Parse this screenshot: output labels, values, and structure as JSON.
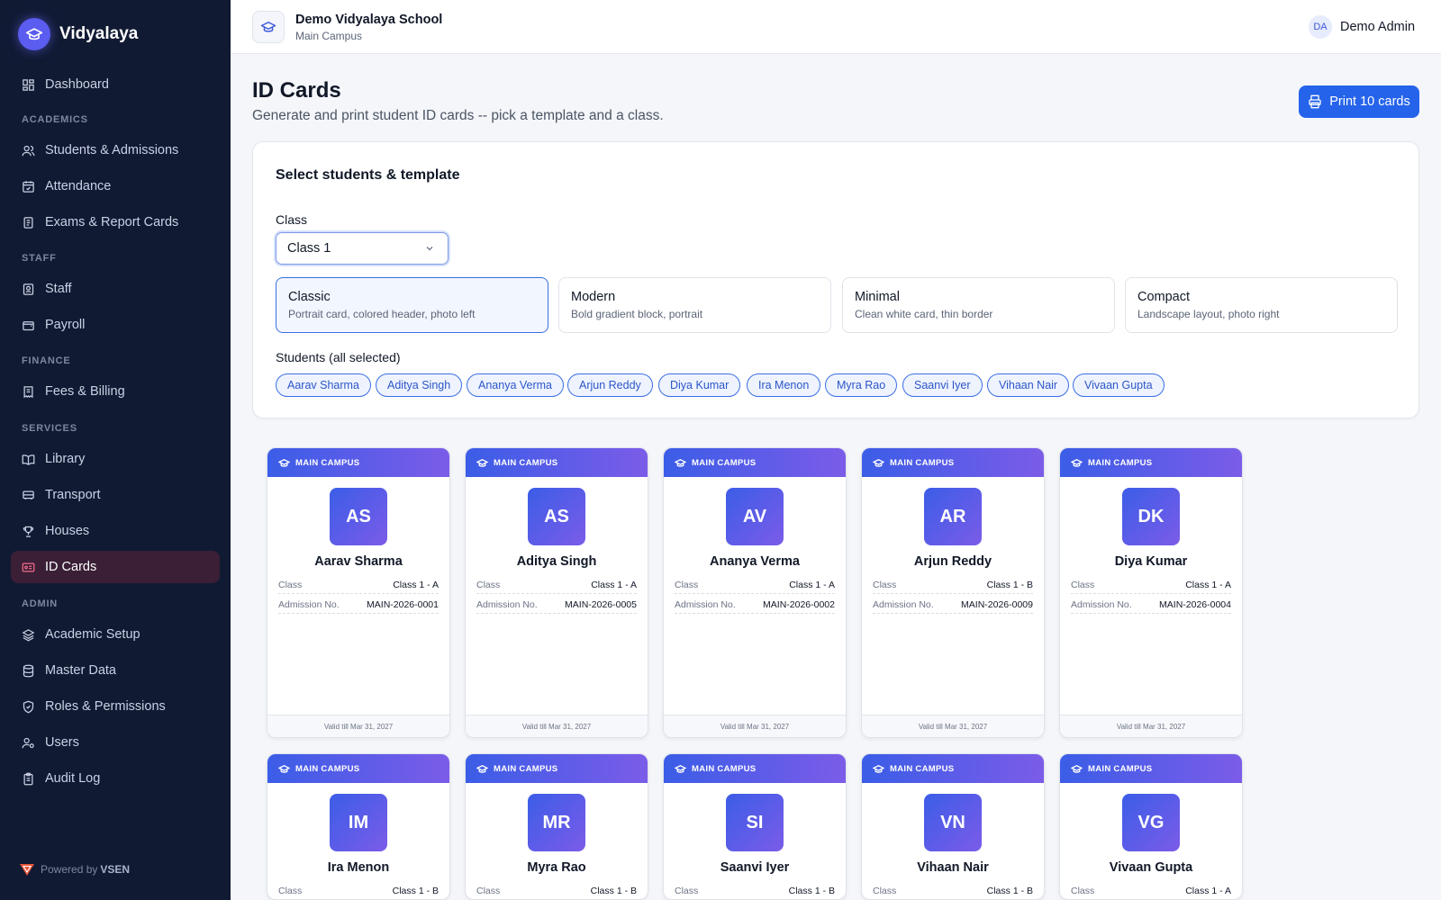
{
  "brand": {
    "name": "Vidyalaya"
  },
  "nav": {
    "dashboard": "Dashboard",
    "section_academics": "ACADEMICS",
    "students": "Students & Admissions",
    "attendance": "Attendance",
    "exams": "Exams & Report Cards",
    "section_staff": "STAFF",
    "staff": "Staff",
    "payroll": "Payroll",
    "section_finance": "FINANCE",
    "fees": "Fees & Billing",
    "section_services": "SERVICES",
    "library": "Library",
    "transport": "Transport",
    "houses": "Houses",
    "id_cards": "ID Cards",
    "section_admin": "ADMIN",
    "academic_setup": "Academic Setup",
    "master_data": "Master Data",
    "roles": "Roles & Permissions",
    "users": "Users",
    "audit_log": "Audit Log"
  },
  "footer": {
    "powered_prefix": "Powered by",
    "powered_brand": "VSEN"
  },
  "topbar": {
    "school_name": "Demo Vidyalaya School",
    "campus": "Main Campus",
    "user_initials": "DA",
    "user_name": "Demo Admin"
  },
  "page": {
    "title": "ID Cards",
    "subtitle": "Generate and print student ID cards -- pick a template and a class.",
    "print_button": "Print 10 cards"
  },
  "panel": {
    "title": "Select students & template",
    "class_label": "Class",
    "class_value": "Class 1",
    "students_label": "Students (all selected)",
    "templates": [
      {
        "name": "Classic",
        "desc": "Portrait card, colored header, photo left"
      },
      {
        "name": "Modern",
        "desc": "Bold gradient block, portrait"
      },
      {
        "name": "Minimal",
        "desc": "Clean white card, thin border"
      },
      {
        "name": "Compact",
        "desc": "Landscape layout, photo right"
      }
    ],
    "students": [
      "Aarav Sharma",
      "Aditya Singh",
      "Ananya Verma",
      "Arjun Reddy",
      "Diya Kumar",
      "Ira Menon",
      "Myra Rao",
      "Saanvi Iyer",
      "Vihaan Nair",
      "Vivaan Gupta"
    ]
  },
  "card_labels": {
    "campus": "MAIN CAMPUS",
    "class": "Class",
    "admission": "Admission No.",
    "valid": "Valid till Mar 31, 2027"
  },
  "cards": [
    {
      "initials": "AS",
      "name": "Aarav Sharma",
      "class": "Class 1 - A",
      "admission": "MAIN-2026-0001"
    },
    {
      "initials": "AS",
      "name": "Aditya Singh",
      "class": "Class 1 - A",
      "admission": "MAIN-2026-0005"
    },
    {
      "initials": "AV",
      "name": "Ananya Verma",
      "class": "Class 1 - A",
      "admission": "MAIN-2026-0002"
    },
    {
      "initials": "AR",
      "name": "Arjun Reddy",
      "class": "Class 1 - B",
      "admission": "MAIN-2026-0009"
    },
    {
      "initials": "DK",
      "name": "Diya Kumar",
      "class": "Class 1 - A",
      "admission": "MAIN-2026-0004"
    },
    {
      "initials": "IM",
      "name": "Ira Menon",
      "class": "Class 1 - B"
    },
    {
      "initials": "MR",
      "name": "Myra Rao",
      "class": "Class 1 - B"
    },
    {
      "initials": "SI",
      "name": "Saanvi Iyer",
      "class": "Class 1 - B"
    },
    {
      "initials": "VN",
      "name": "Vihaan Nair",
      "class": "Class 1 - B"
    },
    {
      "initials": "VG",
      "name": "Vivaan Gupta",
      "class": "Class 1 - A"
    }
  ]
}
